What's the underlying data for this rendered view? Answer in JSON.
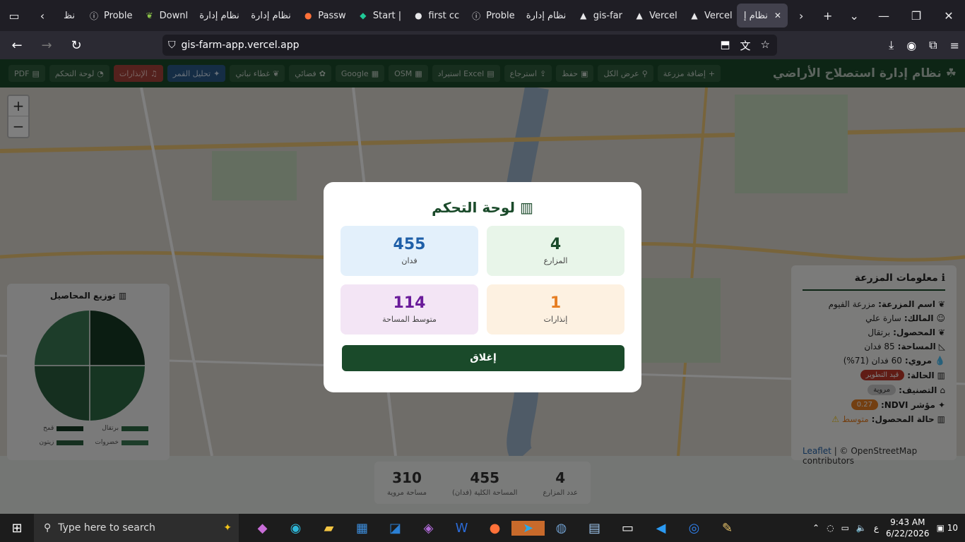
{
  "browser": {
    "tabs": [
      {
        "title": "نظ",
        "icon": "arrow"
      },
      {
        "title": "Proble",
        "icon": "info-icon"
      },
      {
        "title": "Downl",
        "icon": "leaf-icon"
      },
      {
        "title": "نظام إدارة",
        "icon": "none"
      },
      {
        "title": "نظام إدارة",
        "icon": "none"
      },
      {
        "title": "Passw",
        "icon": "firefox-icon"
      },
      {
        "title": "Start |",
        "icon": "diamond-icon"
      },
      {
        "title": "first cc",
        "icon": "github-icon"
      },
      {
        "title": "Proble",
        "icon": "info-icon"
      },
      {
        "title": "نظام إدارة",
        "icon": "none"
      },
      {
        "title": "gis-far",
        "icon": "vercel-icon"
      },
      {
        "title": "Vercel",
        "icon": "vercel-icon"
      },
      {
        "title": "Vercel",
        "icon": "vercel-icon"
      },
      {
        "title": "نظام إ",
        "icon": "active"
      }
    ],
    "url": "gis-farm-app.vercel.app"
  },
  "app": {
    "title": "نظام إدارة استصلاح الأراضي",
    "toolbar": {
      "add_farm": "إضافة مزرعة",
      "show_all": "عرض الكل",
      "save": "حفظ",
      "restore": "استرجاع",
      "import_excel": "استيراد Excel",
      "osm": "OSM",
      "google": "Google",
      "satellite": "فضائي",
      "vegetation": "غطاء نباتي",
      "satellite_analysis": "تحليل القمر",
      "alerts": "الإنذارات",
      "dashboard": "لوحة التحكم",
      "pdf": "PDF"
    }
  },
  "pie": {
    "title": "توزيع المحاصيل",
    "legend": [
      {
        "label": "برتقال",
        "color": "#2d6a45"
      },
      {
        "label": "قمح",
        "color": "#163a24"
      },
      {
        "label": "خضروات",
        "color": "#3b7a55"
      },
      {
        "label": "زيتون",
        "color": "#2a5e3f"
      }
    ]
  },
  "info": {
    "title": "معلومات المزرعة",
    "name_label": "اسم المزرعة:",
    "name": "مزرعة الفيوم",
    "owner_label": "المالك:",
    "owner": "سارة علي",
    "crop_label": "المحصول:",
    "crop": "برتقال",
    "area_label": "المساحة:",
    "area": "85 فدان",
    "irrigated_label": "مروي:",
    "irrigated": "60 فدان (71%)",
    "status_label": "الحالة:",
    "status": "قيد التطوير",
    "class_label": "التصنيف:",
    "class": "مروية",
    "ndvi_label": "مؤشر NDVI:",
    "ndvi": "0.27",
    "crop_status_label": "حالة المحصول:",
    "crop_status": "متوسط"
  },
  "attribution": {
    "leaflet": "Leaflet",
    "osm": "| © OpenStreetMap contributors"
  },
  "stats": [
    {
      "value": "4",
      "label": "عدد المزارع"
    },
    {
      "value": "455",
      "label": "المساحة الكلية (فدان)"
    },
    {
      "value": "310",
      "label": "مساحة مروية"
    }
  ],
  "modal": {
    "title": "لوحة التحكم",
    "cards": [
      {
        "value": "4",
        "label": "المزارع",
        "bg": "#e8f5e9",
        "color": "#1a4a2a"
      },
      {
        "value": "455",
        "label": "فدان",
        "bg": "#e3f0fb",
        "color": "#1f5fa8"
      },
      {
        "value": "1",
        "label": "إنذارات",
        "bg": "#fdf1e1",
        "color": "#e67e22"
      },
      {
        "value": "114",
        "label": "متوسط المساحة",
        "bg": "#f3e5f5",
        "color": "#6a1b9a"
      }
    ],
    "close": "إغلاق"
  },
  "taskbar": {
    "search": "Type here to search",
    "time": "9:43 AM",
    "date": "6/22/2026",
    "lang": "ع",
    "notif": "10"
  }
}
